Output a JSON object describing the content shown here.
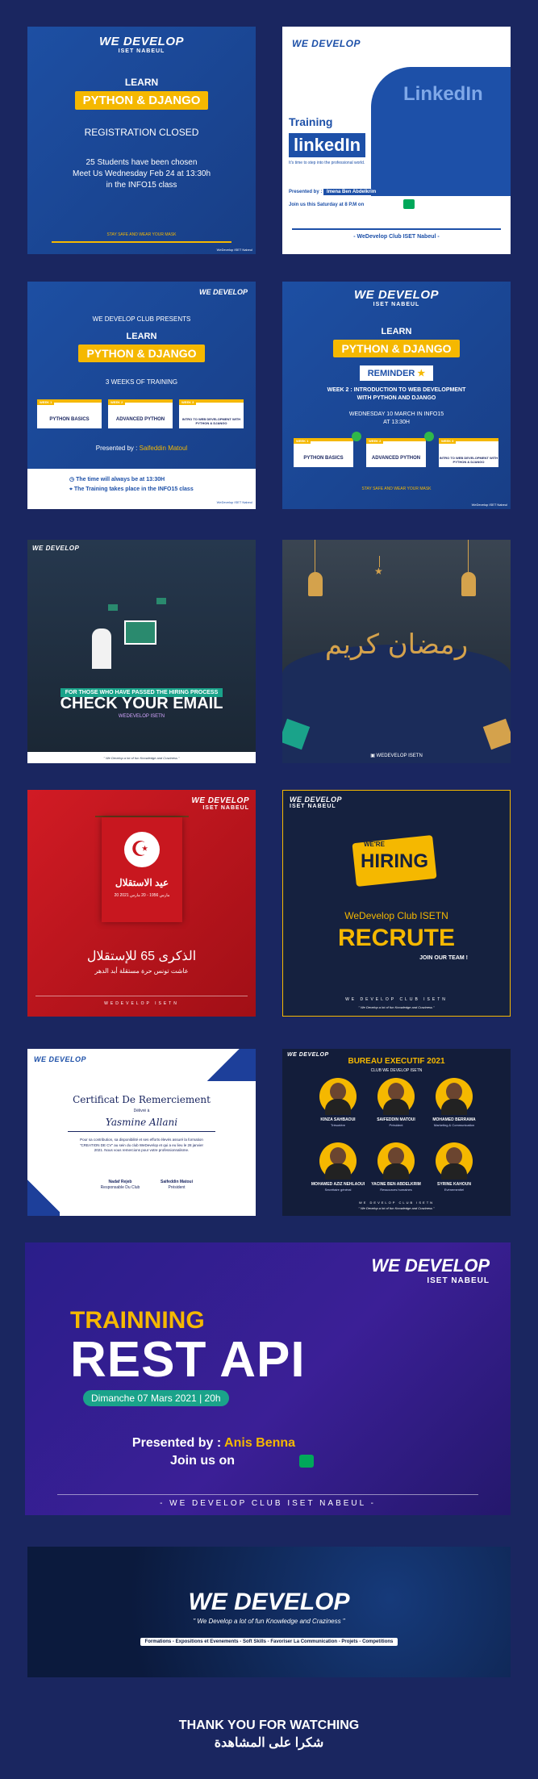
{
  "c1": {
    "logo": "WE DEVELOP",
    "logo_sub": "ISET NABEUL",
    "learn": "LEARN",
    "title": "PYTHON & DJANGO",
    "status": "REGISTRATION CLOSED",
    "l1": "25 Students have been chosen",
    "l2": "Meet Us Wednesday Feb 24 at 13:30h",
    "l3": "in the INFO15 class",
    "footer": "STAY SAFE AND WEAR YOUR MASK",
    "credit": "WeDevelop ISET Nabeul"
  },
  "c2": {
    "logo": "WE DEVELOP",
    "brand": "LinkedIn",
    "training": "Training",
    "title": "linkedIn",
    "tagline": "It's time to step into the professional world.",
    "presented": "Presented by :",
    "presenter": "Imena Ben Abdelkrim",
    "join": "Join us this Saturday at 8 P.M on",
    "footer": "- WeDevelop Club ISET Nabeul -"
  },
  "c3": {
    "logo": "WE DEVELOP",
    "logo_sub": "ISET NABEUL",
    "presents": "WE DEVELOP CLUB PRESENTS",
    "learn": "LEARN",
    "title": "PYTHON & DJANGO",
    "weeks": "3 WEEKS OF TRAINING",
    "m1": "PYTHON BASICS",
    "m2": "ADVANCED PYTHON",
    "m3": "INTRO TO WEB DEVELOPMENT WITH PYTHON & DJANGO",
    "presented": "Presented by :",
    "presenter": "Saifeddin Matoul",
    "i1": "The time will always be at 13:30H",
    "i2": "The Training takes place in the INFO15 class",
    "credit": "WeDevelop ISET Nabeul"
  },
  "c4": {
    "logo": "WE DEVELOP",
    "logo_sub": "ISET NABEUL",
    "learn": "LEARN",
    "title": "PYTHON & DJANGO",
    "reminder": "REMINDER",
    "w1": "WEEK 2 : INTRODUCTION TO WEB DEVELOPMENT",
    "w2": "WITH PYTHON AND DJANGO",
    "d1": "WEDNESDAY 10 MARCH IN INFO15",
    "d2": "AT 13:30H",
    "m1": "PYTHON BASICS",
    "m2": "ADVANCED PYTHON",
    "m3": "INTRO TO WEB DEVELOPMENT WITH PYTHON & DJANGO",
    "footer": "STAY SAFE AND WEAR YOUR MASK",
    "credit": "WeDevelop ISET Nabeul"
  },
  "c5": {
    "logo": "WE DEVELOP",
    "banner": "FOR THOSE WHO HAVE PASSED THE HIRING PROCESS",
    "title": "CHECK YOUR EMAIL",
    "sub": "WEDEVELOP ISETN",
    "footer": "\" We Develop a lot of fun Knowledge and Craziness \""
  },
  "c6": {
    "calligraphy": "رمضان كريم",
    "footer": "WEDEVELOP ISETN"
  },
  "c7": {
    "logo": "WE DEVELOP",
    "logo_sub": "ISET NABEUL",
    "banner_text": "عيد الاستقلال",
    "banner_date": "20 مارس 1956 - 20 مارس 2021",
    "main": "الذكرى 65 للإستقلال",
    "sub": "عاشت تونس حرة مستقلة أبد الدهر",
    "footer": "WEDEVELOP ISETN"
  },
  "c8": {
    "logo": "WE DEVELOP",
    "logo_sub": "ISET NABEUL",
    "were": "WE'RE",
    "hiring": "HIRING",
    "club": "WeDevelop Club ISETN",
    "recrute": "RECRUTE",
    "join": "JOIN OUR TEAM !",
    "footer1": "WE DEVELOP CLUB ISETN",
    "footer2": "\" We Develop a lot of fun Knowledge and Craziness \""
  },
  "c9": {
    "logo": "WE DEVELOP",
    "title": "Certificat De Remerciement",
    "delivered": "Délivré à",
    "name": "Yasmine Allani",
    "body": "Pour sa contribution, sa disponibilité et ses efforts élevés assuré la formation \"CREATION DE CV\" au sein du club WeDevelop et qui a eu lieu le 28 janvier 2021. Nous vous remercions pour votre professionnalisme.",
    "sig1_name": "Nadaf Rejeb",
    "sig1_role": "Responsable Du Club",
    "sig2_name": "Saifeddin Matoui",
    "sig2_role": "Président"
  },
  "c10": {
    "logo": "WE DEVELOP",
    "title": "BUREAU EXECUTIF 2021",
    "sub": "CLUB WE DEVELOP ISETN",
    "people": [
      {
        "name": "KINZA SAHBAOUI",
        "role": "Trésorière"
      },
      {
        "name": "SAIFEDDIN MATOUI",
        "role": "Président"
      },
      {
        "name": "MOHAMED BERRAMA",
        "role": "Marketing & Communication"
      },
      {
        "name": "MOHAMED AZIZ NEHLAOUI",
        "role": "Secrétaire général"
      },
      {
        "name": "YACINE BEN ABDELKRIM",
        "role": "Ressources humaines"
      },
      {
        "name": "SYRINE KAHOUN",
        "role": "Evénementiel"
      }
    ],
    "footer1": "WE DEVELOP CLUB ISETN",
    "footer2": "\" We Develop a lot of fun Knowledge and Craziness \""
  },
  "c11": {
    "logo": "WE DEVELOP",
    "logo_sub": "ISET NABEUL",
    "trainning": "TRAINNING",
    "title": "REST API",
    "date": "Dimanche 07 Mars 2021 | 20h",
    "presented": "Presented by :",
    "presenter": "Anis Benna",
    "join": "Join us on",
    "footer": "- WE DEVELOP CLUB ISET NABEUL -"
  },
  "c12": {
    "logo": "WE DEVELOP",
    "tagline": "\" We Develop a lot of fun Knowledge and Craziness \"",
    "chips": [
      "Formations",
      "Expositions et Evenements",
      "Soft Skills",
      "Favoriser La Communication",
      "Projets",
      "Competitions"
    ]
  },
  "thanks": {
    "en": "THANK YOU FOR WATCHING",
    "ar": "شكرا على المشاهدة"
  },
  "colors": {
    "bg": "#1a2660",
    "blue": "#1d50a8",
    "yellow": "#f5b800",
    "red": "#c8171f",
    "purple": "#3a1f8f"
  }
}
